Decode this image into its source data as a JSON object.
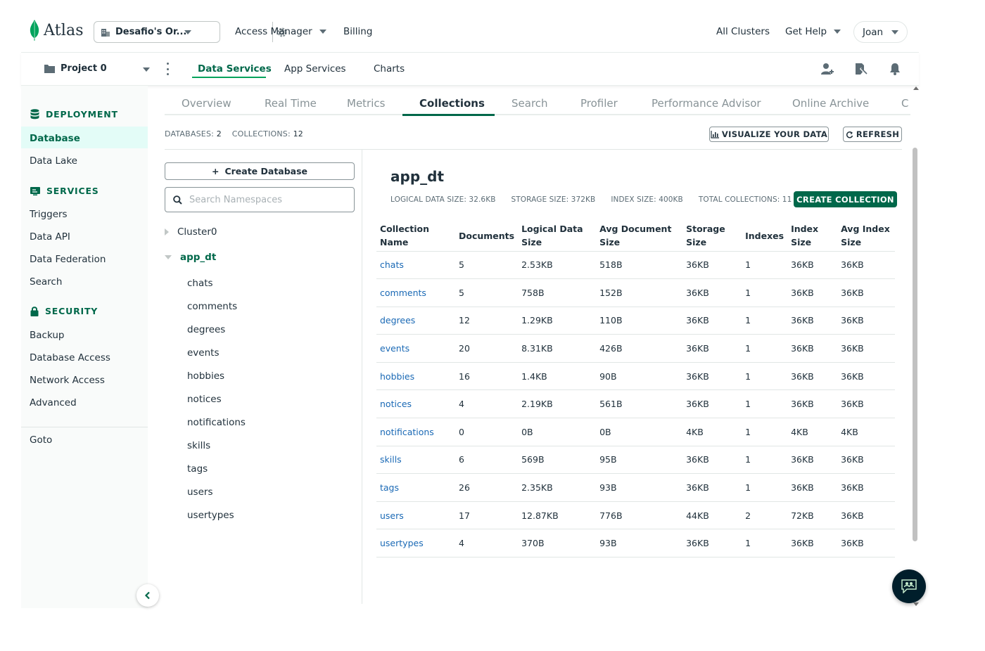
{
  "topbar": {
    "brand": "Atlas",
    "org_name": "Desafio's Or...",
    "nav": [
      "Access Manager",
      "Billing"
    ],
    "right": [
      "All Clusters",
      "Get Help"
    ],
    "user": "Joan"
  },
  "projectbar": {
    "project": "Project 0",
    "tabs": [
      "Data Services",
      "App Services",
      "Charts"
    ],
    "active_tab": "Data Services"
  },
  "sidebar": {
    "deployment_title": "DEPLOYMENT",
    "deployment_items": [
      "Database",
      "Data Lake"
    ],
    "services_title": "SERVICES",
    "services_items": [
      "Triggers",
      "Data API",
      "Data Federation",
      "Search"
    ],
    "security_title": "SECURITY",
    "security_items": [
      "Backup",
      "Database Access",
      "Network Access",
      "Advanced"
    ],
    "goto": "Goto"
  },
  "main": {
    "tabs": [
      "Overview",
      "Real Time",
      "Metrics",
      "Collections",
      "Search",
      "Profiler",
      "Performance Advisor",
      "Online Archive",
      "C"
    ],
    "active_tab": "Collections",
    "databases_label": "DATABASES:",
    "databases_count": "2",
    "collections_label": "COLLECTIONS:",
    "collections_count": "12",
    "visualize_label": "VISUALIZE YOUR DATA",
    "refresh_label": "REFRESH",
    "create_db_label": "Create Database",
    "search_placeholder": "Search Namespaces",
    "tree": {
      "db1": "Cluster0",
      "db2": "app_dt",
      "collections": [
        "chats",
        "comments",
        "degrees",
        "events",
        "hobbies",
        "notices",
        "notifications",
        "skills",
        "tags",
        "users",
        "usertypes"
      ]
    }
  },
  "detail": {
    "db_title": "app_dt",
    "logical_size": "LOGICAL DATA SIZE: 32.6KB",
    "storage_size": "STORAGE SIZE: 372KB",
    "index_size": "INDEX SIZE: 400KB",
    "total_collections": "TOTAL COLLECTIONS: 11",
    "create_collection_label": "CREATE COLLECTION",
    "columns": [
      "Collection Name",
      "Documents",
      "Logical Data Size",
      "Avg Document Size",
      "Storage Size",
      "Indexes",
      "Index Size",
      "Avg Index Size"
    ],
    "rows": [
      [
        "chats",
        "5",
        "2.53KB",
        "518B",
        "36KB",
        "1",
        "36KB",
        "36KB"
      ],
      [
        "comments",
        "5",
        "758B",
        "152B",
        "36KB",
        "1",
        "36KB",
        "36KB"
      ],
      [
        "degrees",
        "12",
        "1.29KB",
        "110B",
        "36KB",
        "1",
        "36KB",
        "36KB"
      ],
      [
        "events",
        "20",
        "8.31KB",
        "426B",
        "36KB",
        "1",
        "36KB",
        "36KB"
      ],
      [
        "hobbies",
        "16",
        "1.4KB",
        "90B",
        "36KB",
        "1",
        "36KB",
        "36KB"
      ],
      [
        "notices",
        "4",
        "2.19KB",
        "561B",
        "36KB",
        "1",
        "36KB",
        "36KB"
      ],
      [
        "notifications",
        "0",
        "0B",
        "0B",
        "4KB",
        "1",
        "4KB",
        "4KB"
      ],
      [
        "skills",
        "6",
        "569B",
        "95B",
        "36KB",
        "1",
        "36KB",
        "36KB"
      ],
      [
        "tags",
        "26",
        "2.35KB",
        "93B",
        "36KB",
        "1",
        "36KB",
        "36KB"
      ],
      [
        "users",
        "17",
        "12.87KB",
        "776B",
        "44KB",
        "2",
        "72KB",
        "36KB"
      ],
      [
        "usertypes",
        "4",
        "370B",
        "93B",
        "36KB",
        "1",
        "36KB",
        "36KB"
      ]
    ]
  },
  "colors": {
    "brand_green": "#00684a",
    "accent_green": "#00a35c",
    "link_blue": "#1a69b5"
  }
}
